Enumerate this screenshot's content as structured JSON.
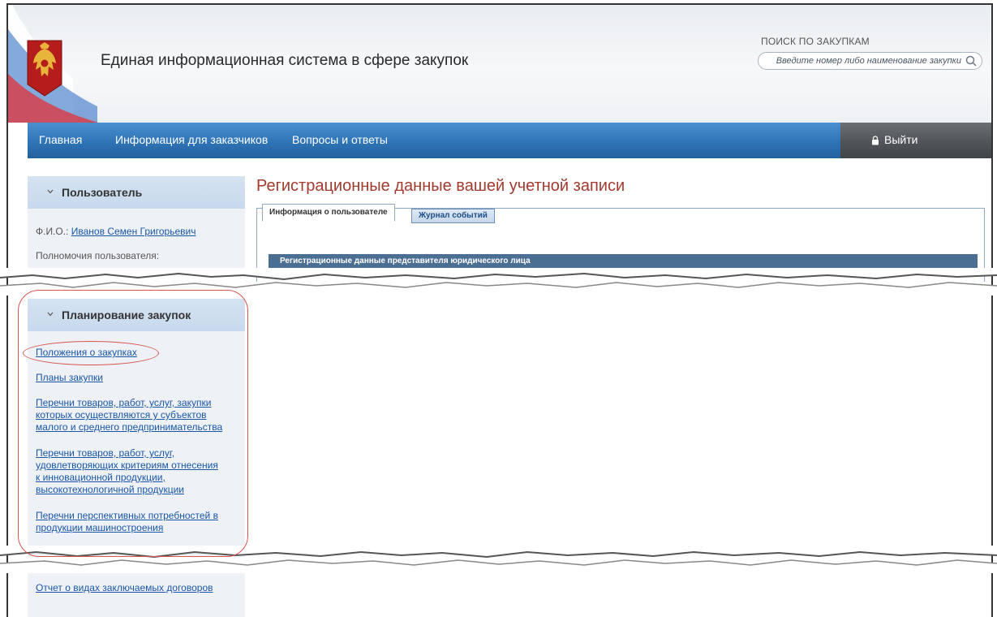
{
  "header": {
    "site_title": "Единая информационная система в сфере закупок",
    "search_label": "ПОИСК ПО ЗАКУПКАМ",
    "search_placeholder": "Введите номер либо наименование закупки"
  },
  "nav": {
    "items": [
      "Главная",
      "Информация для заказчиков",
      "Вопросы и ответы"
    ],
    "logout_label": "Выйти"
  },
  "user_panel": {
    "title": "Пользователь",
    "fio_label": "Ф.И.О.:",
    "fio_value": "Иванов Семен Григорьевич",
    "powers_label": "Полномочия пользователя:"
  },
  "planning_panel": {
    "title": "Планирование закупок",
    "links": [
      [
        "Положения о закупках"
      ],
      [
        "Планы закупки"
      ],
      [
        "Перечни товаров, работ, услуг, закупки",
        "которых осуществляются у субъектов",
        "малого и среднего предпринимательства"
      ],
      [
        "Перечни товаров, работ, услуг,",
        "удовлетворяющих критериям отнесения",
        "к инновационной продукции,",
        "высокотехнологичной продукции"
      ],
      [
        "Перечни перспективных потребностей в",
        "продукции машиностроения"
      ]
    ]
  },
  "bottom_panel": {
    "link": "Отчет о видах заключаемых договоров"
  },
  "main": {
    "page_title": "Регистрационные данные вашей учетной записи",
    "tabs": [
      "Информация о пользователе",
      "Журнал событий"
    ],
    "section_title": "Регистрационные данные представителя юридического лица"
  },
  "colors": {
    "nav_blue": "#2e74b7",
    "title_red": "#a23a2e",
    "link_blue": "#1a56a8",
    "highlight_red": "#d9534f"
  }
}
